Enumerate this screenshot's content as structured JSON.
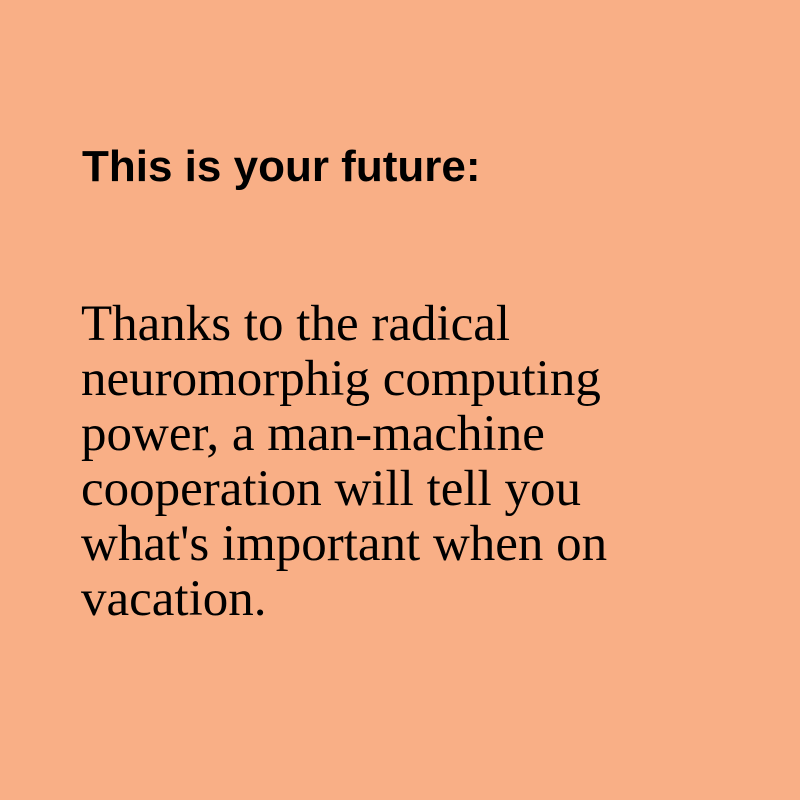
{
  "colors": {
    "background": "#f9af86",
    "text": "#000000"
  },
  "headline": "This is your future:",
  "body": {
    "lines": [
      "Thanks to the radical",
      "neuromorphig computing",
      "power, a man-machine",
      "cooperation will tell you",
      "what's important when on",
      "vacation."
    ]
  }
}
